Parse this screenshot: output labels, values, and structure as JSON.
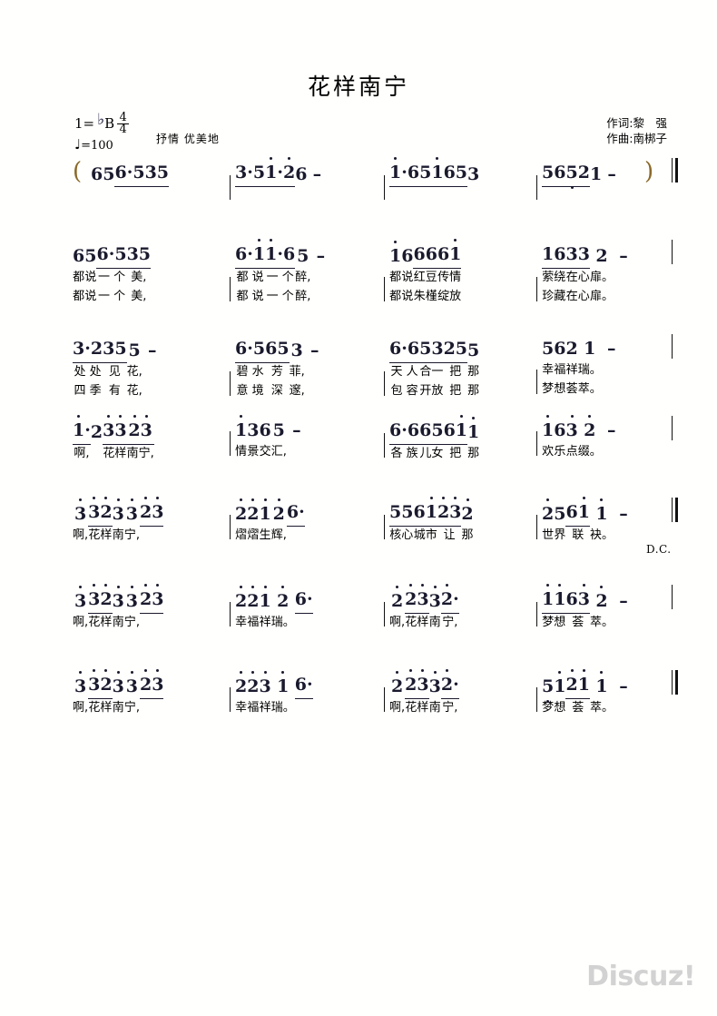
{
  "document": {
    "title": "花样南宁",
    "key_label": "1=",
    "key_flat": "♭",
    "key_note": "B",
    "time_numerator": "4",
    "time_denominator": "4",
    "tempo": "=100",
    "tempo_note": "♩",
    "expression": "抒情 优美地",
    "lyricist": "作词:黎　强",
    "composer": "作曲:南梆子",
    "watermark": "Discuz!",
    "dc_marking": "D.C.",
    "open_paren": "(",
    "close_paren": ")"
  },
  "score": {
    "systems": [
      {
        "id": "intro",
        "measures": [
          {
            "cells": [
              {
                "notes": "6",
                "lyric": "",
                "lyric2": ""
              },
              {
                "notes": "5",
                "lyric": "",
                "lyric2": ""
              },
              {
                "notes": "6·5",
                "lyric": "",
                "lyric2": ""
              },
              {
                "notes": "35",
                "lyric": "",
                "lyric2": ""
              }
            ]
          },
          {
            "cells": [
              {
                "notes": "3·5",
                "lyric": "",
                "lyric2": ""
              },
              {
                "notes": "1̇·2̇",
                "lyric": "",
                "lyric2": ""
              },
              {
                "notes": "6",
                "lyric": "",
                "lyric2": ""
              },
              {
                "notes": "–",
                "lyric": "",
                "lyric2": ""
              }
            ]
          },
          {
            "cells": [
              {
                "notes": "1̇·6",
                "lyric": "",
                "lyric2": ""
              },
              {
                "notes": "51̇",
                "lyric": "",
                "lyric2": ""
              },
              {
                "notes": "65",
                "lyric": "",
                "lyric2": ""
              },
              {
                "notes": "3",
                "lyric": "",
                "lyric2": ""
              }
            ]
          },
          {
            "cells": [
              {
                "notes": "56",
                "lyric": "",
                "lyric2": ""
              },
              {
                "notes": "5̣2",
                "lyric": "",
                "lyric2": ""
              },
              {
                "notes": "1",
                "lyric": "",
                "lyric2": ""
              },
              {
                "notes": "–",
                "lyric": "",
                "lyric2": ""
              }
            ]
          }
        ]
      },
      {
        "id": "line1",
        "measures": [
          {
            "cells": [
              {
                "notes": "6",
                "lyric": "都",
                "lyric2": "都"
              },
              {
                "notes": "5",
                "lyric": "说",
                "lyric2": "说"
              },
              {
                "notes": "6·5",
                "lyric": "一 个",
                "lyric2": "一 个"
              },
              {
                "notes": "35",
                "lyric": "美,",
                "lyric2": "美,"
              }
            ]
          },
          {
            "cells": [
              {
                "notes": "6·1̇",
                "lyric": "都 说",
                "lyric2": "都 说"
              },
              {
                "notes": "1̇·6",
                "lyric": "一 个",
                "lyric2": "一 个"
              },
              {
                "notes": "5",
                "lyric": "醉,",
                "lyric2": "醉,"
              },
              {
                "notes": "–",
                "lyric": "",
                "lyric2": ""
              }
            ]
          },
          {
            "cells": [
              {
                "notes": "1̇",
                "lyric": "都",
                "lyric2": "都"
              },
              {
                "notes": "6",
                "lyric": "说",
                "lyric2": "说"
              },
              {
                "notes": "66",
                "lyric": "红豆",
                "lyric2": "朱槿"
              },
              {
                "notes": "61̇",
                "lyric": "传情",
                "lyric2": "绽放"
              }
            ]
          },
          {
            "cells": [
              {
                "notes": "16",
                "lyric": "萦绕",
                "lyric2": "珍藏"
              },
              {
                "notes": "33",
                "lyric": "在心",
                "lyric2": "在心"
              },
              {
                "notes": "2",
                "lyric": "扉。",
                "lyric2": "扉。"
              },
              {
                "notes": "–",
                "lyric": "",
                "lyric2": ""
              }
            ]
          }
        ]
      },
      {
        "id": "line2",
        "measures": [
          {
            "cells": [
              {
                "notes": "3·2",
                "lyric": "处 处",
                "lyric2": "四 季"
              },
              {
                "notes": "35",
                "lyric": "见",
                "lyric2": "有"
              },
              {
                "notes": "5",
                "lyric": "花,",
                "lyric2": "花,"
              },
              {
                "notes": "–",
                "lyric": "",
                "lyric2": ""
              }
            ]
          },
          {
            "cells": [
              {
                "notes": "6·5",
                "lyric": "碧 水",
                "lyric2": "意 境"
              },
              {
                "notes": "65",
                "lyric": "芳",
                "lyric2": "深"
              },
              {
                "notes": "3",
                "lyric": "菲,",
                "lyric2": "邃,"
              },
              {
                "notes": "–",
                "lyric": "",
                "lyric2": ""
              }
            ]
          },
          {
            "cells": [
              {
                "notes": "6·6",
                "lyric": "天 人",
                "lyric2": "包 容"
              },
              {
                "notes": "53",
                "lyric": "合一",
                "lyric2": "开放"
              },
              {
                "notes": "25",
                "lyric": "把",
                "lyric2": "把"
              },
              {
                "notes": "5",
                "lyric": "那",
                "lyric2": "那"
              }
            ]
          },
          {
            "cells": [
              {
                "notes": "5",
                "lyric": "幸",
                "lyric2": "梦"
              },
              {
                "notes": "6",
                "lyric": "福",
                "lyric2": "想"
              },
              {
                "notes": "2",
                "lyric": "祥",
                "lyric2": "荟"
              },
              {
                "notes": "1",
                "lyric": "瑞。",
                "lyric2": "萃。"
              },
              {
                "notes": "–",
                "lyric": "",
                "lyric2": ""
              }
            ]
          }
        ]
      },
      {
        "id": "line3",
        "measures": [
          {
            "cells": [
              {
                "notes": "1̇·",
                "lyric": "啊,",
                "lyric2": ""
              },
              {
                "notes": "2",
                "lyric": "",
                "lyric2": ""
              },
              {
                "notes": "3̇3̇",
                "lyric": "花样",
                "lyric2": ""
              },
              {
                "notes": "2̇3̇",
                "lyric": "南宁,",
                "lyric2": ""
              }
            ]
          },
          {
            "cells": [
              {
                "notes": "1̇",
                "lyric": "情",
                "lyric2": ""
              },
              {
                "notes": "3",
                "lyric": "景",
                "lyric2": ""
              },
              {
                "notes": "6",
                "lyric": "交",
                "lyric2": ""
              },
              {
                "notes": "5",
                "lyric": "汇,",
                "lyric2": ""
              },
              {
                "notes": "–",
                "lyric": "",
                "lyric2": ""
              }
            ]
          },
          {
            "cells": [
              {
                "notes": "6·6",
                "lyric": "各 族",
                "lyric2": ""
              },
              {
                "notes": "65",
                "lyric": "儿女",
                "lyric2": ""
              },
              {
                "notes": "61̇",
                "lyric": "把",
                "lyric2": ""
              },
              {
                "notes": "1̇",
                "lyric": "那",
                "lyric2": ""
              }
            ]
          },
          {
            "cells": [
              {
                "notes": "1̇",
                "lyric": "欢",
                "lyric2": ""
              },
              {
                "notes": "6",
                "lyric": "乐",
                "lyric2": ""
              },
              {
                "notes": "3̇",
                "lyric": "点",
                "lyric2": ""
              },
              {
                "notes": "2̇",
                "lyric": "缀。",
                "lyric2": ""
              },
              {
                "notes": "–",
                "lyric": "",
                "lyric2": ""
              }
            ]
          }
        ]
      },
      {
        "id": "line4",
        "measures": [
          {
            "cells": [
              {
                "notes": "3̇",
                "lyric": "啊,",
                "lyric2": ""
              },
              {
                "notes": "3̇2̇",
                "lyric": "花样",
                "lyric2": ""
              },
              {
                "notes": "3̇",
                "lyric": "南",
                "lyric2": ""
              },
              {
                "notes": "3̇",
                "lyric": "宁,",
                "lyric2": ""
              },
              {
                "notes": "2̇3̇",
                "lyric": "",
                "lyric2": ""
              }
            ]
          },
          {
            "cells": [
              {
                "notes": "2̇",
                "lyric": "熠",
                "lyric2": ""
              },
              {
                "notes": "2̇",
                "lyric": "熠",
                "lyric2": ""
              },
              {
                "notes": "1̇",
                "lyric": "生",
                "lyric2": ""
              },
              {
                "notes": "2̇",
                "lyric": "辉,",
                "lyric2": ""
              },
              {
                "notes": "6·",
                "lyric": "",
                "lyric2": ""
              }
            ]
          },
          {
            "cells": [
              {
                "notes": "55",
                "lyric": "核心",
                "lyric2": ""
              },
              {
                "notes": "61̇",
                "lyric": "城市",
                "lyric2": ""
              },
              {
                "notes": "2̇3̇",
                "lyric": "让",
                "lyric2": ""
              },
              {
                "notes": "2̇",
                "lyric": "那",
                "lyric2": ""
              }
            ]
          },
          {
            "cells": [
              {
                "notes": "2̇",
                "lyric": "世",
                "lyric2": ""
              },
              {
                "notes": "5",
                "lyric": "界",
                "lyric2": ""
              },
              {
                "notes": "61̇",
                "lyric": "联",
                "lyric2": ""
              },
              {
                "notes": "1̇",
                "lyric": "袂。",
                "lyric2": ""
              },
              {
                "notes": "–",
                "lyric": "",
                "lyric2": ""
              }
            ]
          }
        ]
      },
      {
        "id": "line5",
        "measures": [
          {
            "cells": [
              {
                "notes": "3̇",
                "lyric": "啊,",
                "lyric2": ""
              },
              {
                "notes": "3̇2̇",
                "lyric": "花样",
                "lyric2": ""
              },
              {
                "notes": "3̇",
                "lyric": "南",
                "lyric2": ""
              },
              {
                "notes": "3̇",
                "lyric": "宁,",
                "lyric2": ""
              },
              {
                "notes": "2̇3̇",
                "lyric": "",
                "lyric2": ""
              }
            ]
          },
          {
            "cells": [
              {
                "notes": "2̇",
                "lyric": "幸",
                "lyric2": ""
              },
              {
                "notes": "2̇",
                "lyric": "福",
                "lyric2": ""
              },
              {
                "notes": "1̇",
                "lyric": "祥",
                "lyric2": ""
              },
              {
                "notes": "2̇",
                "lyric": "瑞。",
                "lyric2": ""
              },
              {
                "notes": "6·",
                "lyric": "",
                "lyric2": ""
              }
            ]
          },
          {
            "cells": [
              {
                "notes": "2̇",
                "lyric": "啊,",
                "lyric2": ""
              },
              {
                "notes": "2̇3̇",
                "lyric": "花样",
                "lyric2": ""
              },
              {
                "notes": "3̇",
                "lyric": "南",
                "lyric2": ""
              },
              {
                "notes": "2̇·",
                "lyric": "宁,",
                "lyric2": ""
              }
            ]
          },
          {
            "cells": [
              {
                "notes": "1̇1̇",
                "lyric": "梦想",
                "lyric2": ""
              },
              {
                "notes": "63̇",
                "lyric": "荟",
                "lyric2": ""
              },
              {
                "notes": "2̇",
                "lyric": "萃。",
                "lyric2": ""
              },
              {
                "notes": "–",
                "lyric": "",
                "lyric2": ""
              }
            ]
          }
        ]
      },
      {
        "id": "line6",
        "measures": [
          {
            "cells": [
              {
                "notes": "3̇",
                "lyric": "啊,",
                "lyric2": ""
              },
              {
                "notes": "3̇2̇",
                "lyric": "花样",
                "lyric2": ""
              },
              {
                "notes": "3̇",
                "lyric": "南",
                "lyric2": ""
              },
              {
                "notes": "3̇",
                "lyric": "宁,",
                "lyric2": ""
              },
              {
                "notes": "2̇3̇",
                "lyric": "",
                "lyric2": ""
              }
            ]
          },
          {
            "cells": [
              {
                "notes": "2̇",
                "lyric": "幸",
                "lyric2": ""
              },
              {
                "notes": "2̇",
                "lyric": "福",
                "lyric2": ""
              },
              {
                "notes": "3̇",
                "lyric": "祥",
                "lyric2": ""
              },
              {
                "notes": "1̇",
                "lyric": "瑞。",
                "lyric2": ""
              },
              {
                "notes": "6·",
                "lyric": "",
                "lyric2": ""
              }
            ]
          },
          {
            "cells": [
              {
                "notes": "2̇",
                "lyric": "啊,",
                "lyric2": ""
              },
              {
                "notes": "2̇3̇",
                "lyric": "花样",
                "lyric2": ""
              },
              {
                "notes": "3̇",
                "lyric": "南",
                "lyric2": ""
              },
              {
                "notes": "2̇·",
                "lyric": "宁,",
                "lyric2": ""
              }
            ]
          },
          {
            "cells": [
              {
                "notes": "5̣",
                "lyric": "梦",
                "lyric2": ""
              },
              {
                "notes": "1̇",
                "lyric": "想",
                "lyric2": ""
              },
              {
                "notes": "2̇1̇",
                "lyric": "荟",
                "lyric2": ""
              },
              {
                "notes": "1̇",
                "lyric": "萃。",
                "lyric2": ""
              },
              {
                "notes": "–",
                "lyric": "",
                "lyric2": ""
              }
            ]
          }
        ]
      }
    ]
  }
}
